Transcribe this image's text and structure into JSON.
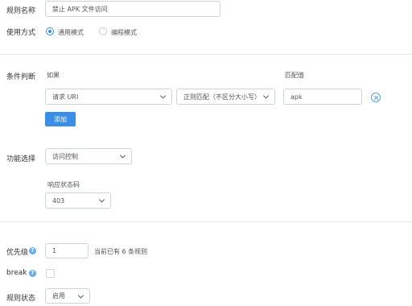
{
  "rule_name": {
    "label": "规则名称",
    "value": "禁止 APK 文件访问"
  },
  "usage_mode": {
    "label": "使用方式",
    "options": [
      "通用模式",
      "编程模式"
    ],
    "selected": "通用模式"
  },
  "conditions": {
    "label": "条件判断",
    "col_if": "如果",
    "col_match": "匹配值",
    "row": {
      "field": "请求 URI",
      "operator": "正则匹配（不区分大小写）",
      "value": "apk"
    },
    "add_button": "添加"
  },
  "function": {
    "label": "功能选择",
    "value": "访问控制",
    "status_code_label": "响应状态码",
    "status_code_value": "403"
  },
  "priority": {
    "label": "优先级",
    "value": "1",
    "note": "当前已有 6 条规则"
  },
  "break": {
    "label": "break",
    "checked": false
  },
  "rule_status": {
    "label": "规则状态",
    "value": "启用"
  },
  "colors": {
    "accent": "#3a8ee6",
    "border": "#cfd4db"
  }
}
